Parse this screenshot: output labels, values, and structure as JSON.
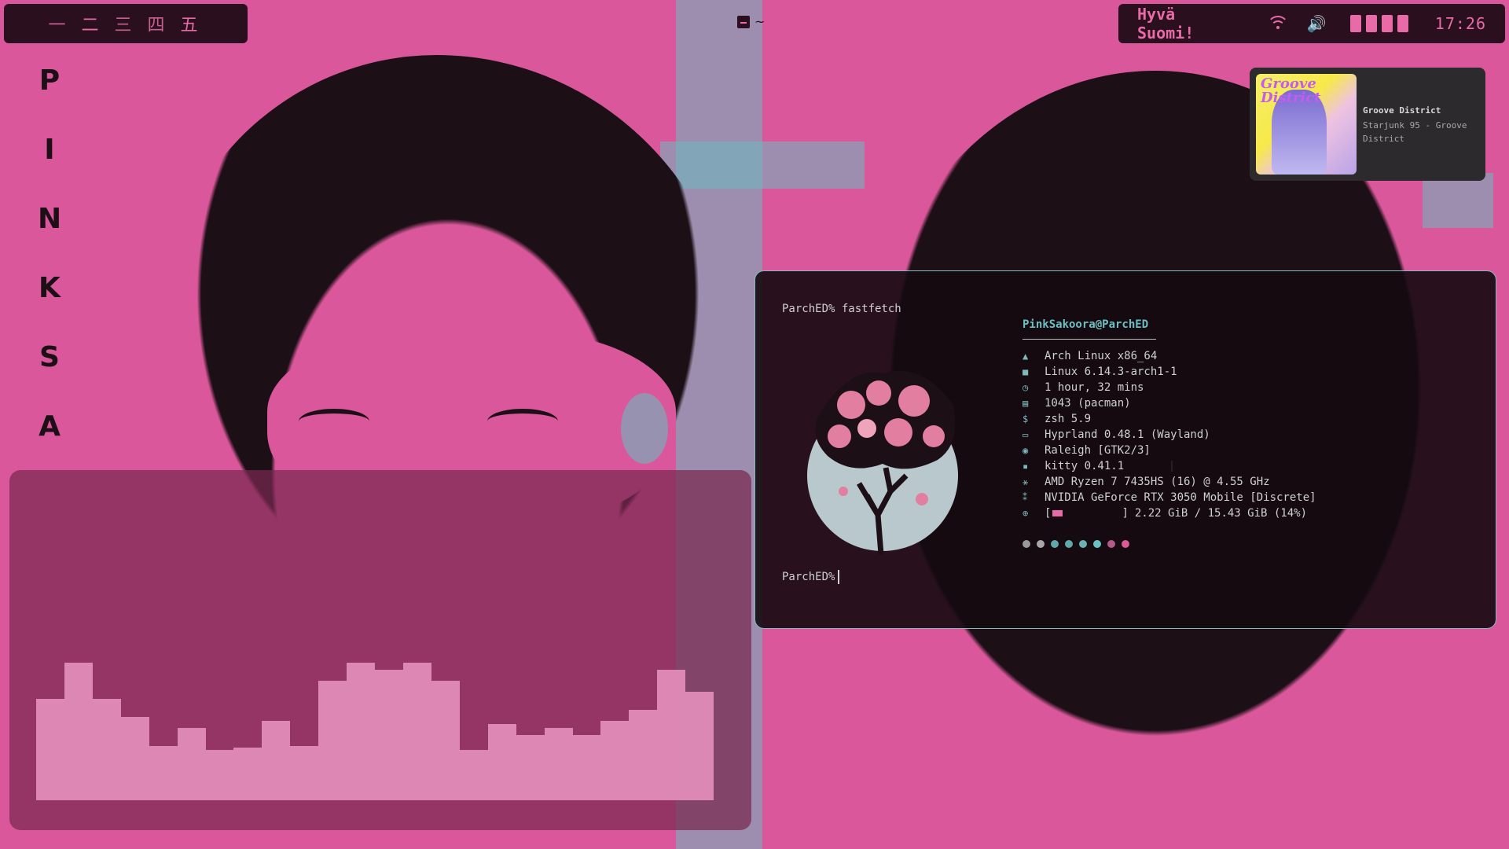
{
  "workspaces": [
    {
      "label": "一",
      "active": false
    },
    {
      "label": "二",
      "active": true
    },
    {
      "label": "三",
      "active": false
    },
    {
      "label": "四",
      "active": false
    },
    {
      "label": "五",
      "active": true
    }
  ],
  "center_indicator": {
    "label": "~"
  },
  "status": {
    "greeting": "Hyvä Suomi!",
    "icons": [
      "wifi-icon",
      "volume-icon"
    ],
    "battery_cells": 4,
    "time": "17:26"
  },
  "side_title": [
    "P",
    "I",
    "N",
    "K",
    "S",
    "A"
  ],
  "media": {
    "album_title": "Groove District",
    "track": "Groove District",
    "artist_line1": "Starjunk 95 - Groove",
    "artist_line2": "District"
  },
  "terminal": {
    "prompt1": "ParchED% fastfetch",
    "userhost": "PinkSakoora@ParchED",
    "info": [
      {
        "icon": "arch-icon",
        "glyph": "▲",
        "value": "Arch Linux x86_64"
      },
      {
        "icon": "kernel-icon",
        "glyph": "■",
        "value": "Linux 6.14.3-arch1-1"
      },
      {
        "icon": "clock-icon",
        "glyph": "◷",
        "value": "1 hour, 32 mins"
      },
      {
        "icon": "package-icon",
        "glyph": "▤",
        "value": "1043 (pacman)"
      },
      {
        "icon": "shell-icon",
        "glyph": "$",
        "value": "zsh 5.9"
      },
      {
        "icon": "window-icon",
        "glyph": "▭",
        "value": "Hyprland 0.48.1 (Wayland)"
      },
      {
        "icon": "palette-icon",
        "glyph": "◉",
        "value": "Raleigh [GTK2/3]"
      },
      {
        "icon": "terminal-icon",
        "glyph": "▪",
        "value": "kitty 0.41.1"
      },
      {
        "icon": "cpu-icon",
        "glyph": "⚹",
        "value": "AMD Ryzen 7 7435HS (16) @ 4.55 GHz"
      },
      {
        "icon": "gpu-icon",
        "glyph": "⁑",
        "value": "NVIDIA GeForce RTX 3050 Mobile [Discrete]"
      }
    ],
    "memory": {
      "open": "[",
      "close": "]",
      "value": "2.22 GiB / 15.43 GiB (14%)",
      "percent": 14
    },
    "palette": [
      "#9a9a9a",
      "#a8a8a8",
      "#5fa8ac",
      "#5fa8ac",
      "#6bb0b4",
      "#6bc0c4",
      "#b45a8a",
      "#d85a96"
    ],
    "prompt2": "ParchED%"
  },
  "visualizer": {
    "levels": [
      0.56,
      0.76,
      0.56,
      0.46,
      0.3,
      0.4,
      0.28,
      0.29,
      0.44,
      0.3,
      0.66,
      0.76,
      0.72,
      0.76,
      0.66,
      0.28,
      0.42,
      0.36,
      0.4,
      0.36,
      0.44,
      0.5,
      0.72,
      0.6
    ],
    "color": "#e490bd"
  },
  "colors": {
    "desktop": "#d9579a",
    "bar_bg": "#2a0f1e",
    "accent": "#e86aa6",
    "cyan": "#6bc0c4"
  }
}
